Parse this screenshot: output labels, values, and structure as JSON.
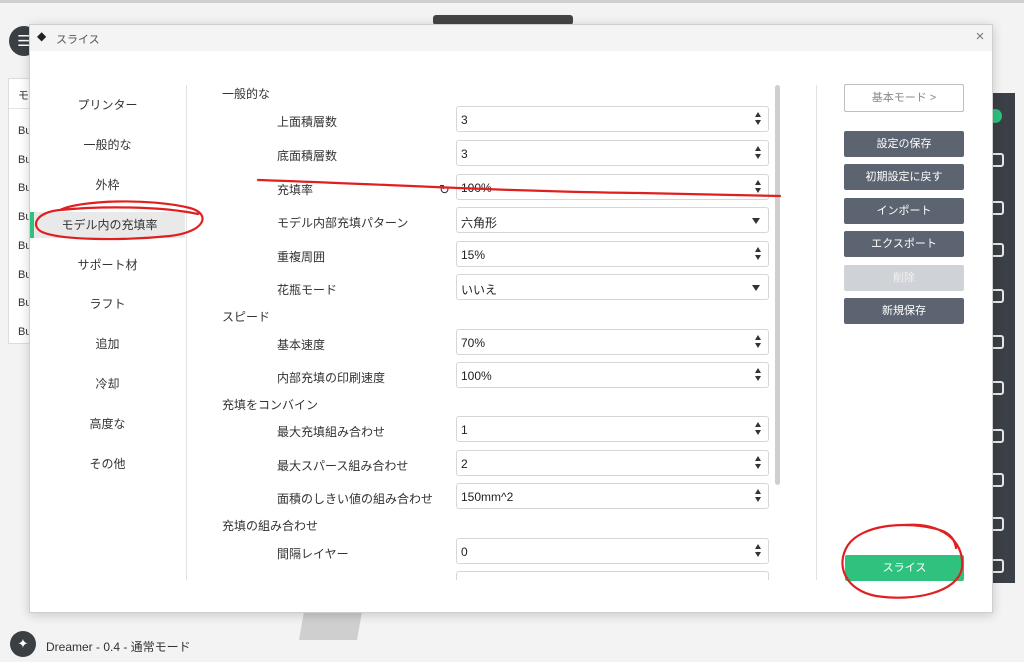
{
  "background": {
    "left_panel_header": "モ",
    "left_panel_items": [
      "Bu",
      "Bu",
      "Bu",
      "Bu",
      "Bu",
      "Bu",
      "Bu",
      "Bu"
    ],
    "status_text": "Dreamer - 0.4 - 通常モード"
  },
  "dialog": {
    "title": "スライス",
    "close_icon": "×",
    "nav": [
      {
        "label": "プリンター",
        "active": false
      },
      {
        "label": "一般的な",
        "active": false
      },
      {
        "label": "外枠",
        "active": false
      },
      {
        "label": "モデル内の充填率",
        "active": true
      },
      {
        "label": "サポート材",
        "active": false
      },
      {
        "label": "ラフト",
        "active": false
      },
      {
        "label": "追加",
        "active": false
      },
      {
        "label": "冷却",
        "active": false
      },
      {
        "label": "高度な",
        "active": false
      },
      {
        "label": "その他",
        "active": false
      }
    ],
    "sections": [
      {
        "title": "一般的な",
        "fields": [
          {
            "label": "上面積層数",
            "value": "3",
            "control": "spinner"
          },
          {
            "label": "底面積層数",
            "value": "3",
            "control": "spinner"
          },
          {
            "label": "充填率",
            "value": "100%",
            "control": "spinner",
            "reset_icon": true
          },
          {
            "label": "モデル内部充填パターン",
            "value": "六角形",
            "control": "dropdown"
          },
          {
            "label": "重複周囲",
            "value": "15%",
            "control": "spinner"
          },
          {
            "label": "花瓶モード",
            "value": "いいえ",
            "control": "dropdown"
          }
        ]
      },
      {
        "title": "スピード",
        "fields": [
          {
            "label": "基本速度",
            "value": "70%",
            "control": "spinner"
          },
          {
            "label": "内部充填の印刷速度",
            "value": "100%",
            "control": "spinner"
          }
        ]
      },
      {
        "title": "充填をコンバイン",
        "fields": [
          {
            "label": "最大充填組み合わせ",
            "value": "1",
            "control": "spinner"
          },
          {
            "label": "最大スパース組み合わせ",
            "value": "2",
            "control": "spinner"
          },
          {
            "label": "面積のしきい値の組み合わせ",
            "value": "150mm^2",
            "control": "spinner"
          }
        ]
      },
      {
        "title": "充填の組み合わせ",
        "fields": [
          {
            "label": "間隔レイヤー",
            "value": "0",
            "control": "spinner"
          },
          {
            "label": "",
            "value": "",
            "control": "spinner"
          }
        ]
      }
    ],
    "buttons": {
      "basic_mode": "基本モード >",
      "save_settings": "設定の保存",
      "reset_defaults": "初期設定に戻す",
      "import": "インポート",
      "export": "エクスポート",
      "delete": "削除",
      "new_save": "新規保存",
      "slice": "スライス"
    },
    "colors": {
      "accent": "#2ec27e",
      "button": "#5b6470",
      "annotation": "#e02020"
    }
  }
}
